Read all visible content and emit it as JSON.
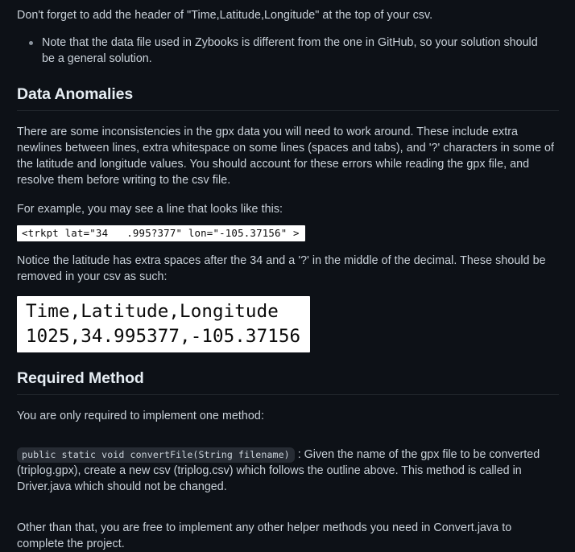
{
  "document": {
    "theme": {
      "background": "#0d1117",
      "text": "#c9d1d9",
      "heading": "#e6edf3",
      "rule": "#23282e",
      "code_block_bg": "#ffffff",
      "code_block_text": "#0a0a0a",
      "inline_code_bg": "#272c34"
    },
    "intro_paragraph": "Don't forget to add the header of \"Time,Latitude,Longitude\" at the top of your csv.",
    "intro_bullets": [
      "Note that the data file used in Zybooks is different from the one in GitHub, so your solution should be a general solution."
    ],
    "sections": [
      {
        "id": "data-anomalies",
        "heading": "Data Anomalies",
        "paragraph_1": "There are some inconsistencies in the gpx data you will need to work around. These include extra newlines between lines, extra whitespace on some lines (spaces and tabs), and '?' characters in some of the latitude and longitude values. You should account for these errors while reading the gpx file, and resolve them before writing to the csv file.",
        "paragraph_2": "For example, you may see a line that looks like this:",
        "code_example_1": "<trkpt lat=\"34   .995?377\" lon=\"-105.37156\" >",
        "paragraph_3": "Notice the latitude has extra spaces after the 34 and a '?' in the middle of the decimal. These should be removed in your csv as such:",
        "code_example_2_line_1": "Time,Latitude,Longitude",
        "code_example_2_line_2": "1025,34.995377,-105.37156"
      },
      {
        "id": "required-method",
        "heading": "Required Method",
        "paragraph_1": "You are only required to implement one method:",
        "method_signature": "public static void convertFile(String filename)",
        "method_description": " : Given the name of the gpx file to be converted (triplog.gpx), create a new csv (triplog.csv) which follows the outline above. This method is called in Driver.java which should not be changed.",
        "paragraph_2": "Other than that, you are free to implement any other helper methods you need in Convert.java to complete the project."
      }
    ]
  }
}
